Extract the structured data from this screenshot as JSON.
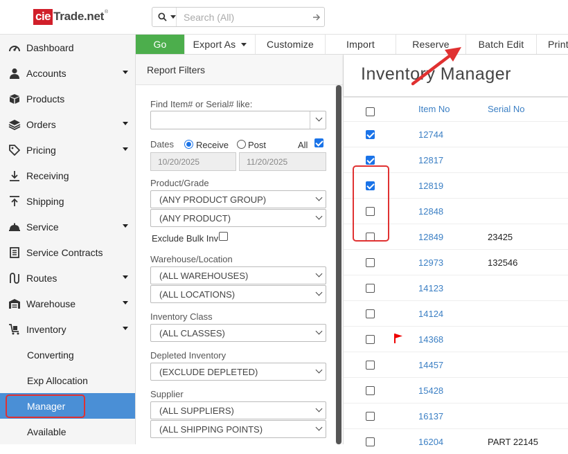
{
  "brand": {
    "cie": "cie",
    "trade": "Trade.net",
    "reg": "®"
  },
  "search": {
    "placeholder": "Search (All)"
  },
  "sidebar": {
    "items": [
      {
        "label": "Dashboard",
        "icon": "dashboard-icon",
        "caret": false
      },
      {
        "label": "Accounts",
        "icon": "user-icon",
        "caret": true
      },
      {
        "label": "Products",
        "icon": "box-icon",
        "caret": false
      },
      {
        "label": "Orders",
        "icon": "layers-icon",
        "caret": true
      },
      {
        "label": "Pricing",
        "icon": "tag-icon",
        "caret": true
      },
      {
        "label": "Receiving",
        "icon": "receive-arrow-icon",
        "caret": false
      },
      {
        "label": "Shipping",
        "icon": "ship-arrow-icon",
        "caret": false
      },
      {
        "label": "Service",
        "icon": "bell-service-icon",
        "caret": true
      },
      {
        "label": "Service Contracts",
        "icon": "document-icon",
        "caret": false
      },
      {
        "label": "Routes",
        "icon": "route-icon",
        "caret": true
      },
      {
        "label": "Warehouse",
        "icon": "warehouse-icon",
        "caret": true
      },
      {
        "label": "Inventory",
        "icon": "cart-icon",
        "caret": true
      }
    ],
    "sub_items": [
      "Converting",
      "Exp Allocation",
      "Manager",
      "Available"
    ],
    "active_sub": "Manager"
  },
  "toolbar": {
    "go": "Go",
    "export_as": "Export As",
    "customize": "Customize",
    "import": "Import",
    "reserve": "Reserve",
    "batch_edit": "Batch Edit",
    "print": "Print",
    "go_color": "#4cae4c"
  },
  "filters": {
    "title": "Report Filters",
    "find_label": "Find Item# or Serial# like:",
    "find_value": "",
    "dates_label": "Dates",
    "receive_label": "Receive",
    "post_label": "Post",
    "all_label": "All",
    "date_from": "10/20/2025",
    "date_to": "11/20/2025",
    "product_grade_label": "Product/Grade",
    "product_group": "(ANY PRODUCT GROUP)",
    "product": "(ANY PRODUCT)",
    "exclude_bulk_label": "Exclude Bulk Inv",
    "warehouse_label": "Warehouse/Location",
    "warehouses": "(ALL WAREHOUSES)",
    "locations": "(ALL LOCATIONS)",
    "inventory_class_label": "Inventory Class",
    "classes": "(ALL CLASSES)",
    "depleted_label": "Depleted Inventory",
    "depleted": "(EXCLUDE DEPLETED)",
    "supplier_label": "Supplier",
    "suppliers": "(ALL SUPPLIERS)",
    "shipping_points": "(ALL SHIPPING POINTS)"
  },
  "main": {
    "title": "Inventory Manager",
    "col_item": "Item No",
    "col_serial": "Serial No",
    "rows": [
      {
        "item": "12744",
        "serial": "",
        "checked": true,
        "flag": false
      },
      {
        "item": "12817",
        "serial": "",
        "checked": true,
        "flag": false
      },
      {
        "item": "12819",
        "serial": "",
        "checked": true,
        "flag": false
      },
      {
        "item": "12848",
        "serial": "",
        "checked": false,
        "flag": false
      },
      {
        "item": "12849",
        "serial": "23425",
        "checked": false,
        "flag": false
      },
      {
        "item": "12973",
        "serial": "132546",
        "checked": false,
        "flag": false
      },
      {
        "item": "14123",
        "serial": "",
        "checked": false,
        "flag": false
      },
      {
        "item": "14124",
        "serial": "",
        "checked": false,
        "flag": false
      },
      {
        "item": "14368",
        "serial": "",
        "checked": false,
        "flag": true
      },
      {
        "item": "14457",
        "serial": "",
        "checked": false,
        "flag": false
      },
      {
        "item": "15428",
        "serial": "",
        "checked": false,
        "flag": false
      },
      {
        "item": "16137",
        "serial": "",
        "checked": false,
        "flag": false
      },
      {
        "item": "16204",
        "serial": "PART 22145",
        "checked": false,
        "flag": false
      }
    ]
  },
  "colors": {
    "accent": "#4a8fd6",
    "link": "#3b7fc4",
    "highlight": "#e03131",
    "brand_red": "#d11f2a"
  }
}
